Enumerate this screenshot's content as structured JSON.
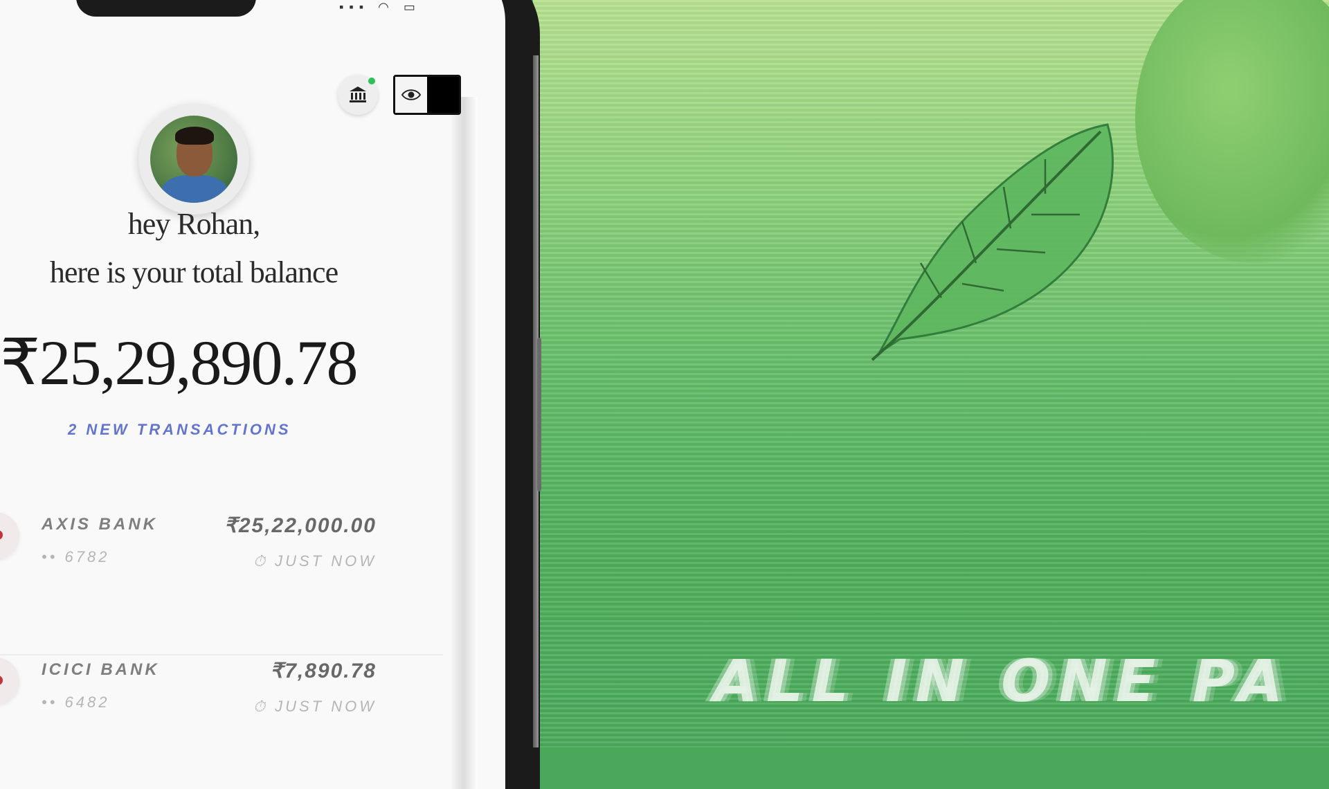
{
  "phone": {
    "greeting_line1": "hey Rohan,",
    "greeting_line2": "here is your total balance",
    "balance": "₹25,29,890.78",
    "new_transactions": "2 NEW TRANSACTIONS",
    "transactions": [
      {
        "bank": "AXIS BANK",
        "account": "•• 6782",
        "amount": "₹25,22,000.00",
        "time": "⏱ JUST NOW"
      },
      {
        "bank": "ICICI BANK",
        "account": "•• 6482",
        "amount": "₹7,890.78",
        "time": "⏱ JUST NOW"
      }
    ],
    "icons": {
      "bank": "bank-icon",
      "visibility": "eye-icon"
    },
    "colors": {
      "accent_blue": "#3d53c6",
      "notification_green": "#2fbf5a"
    }
  },
  "promo": {
    "tagline": "ALL IN ONE PA",
    "colors": {
      "background_top": "#b6e08e",
      "background_bottom": "#49a95a"
    }
  }
}
